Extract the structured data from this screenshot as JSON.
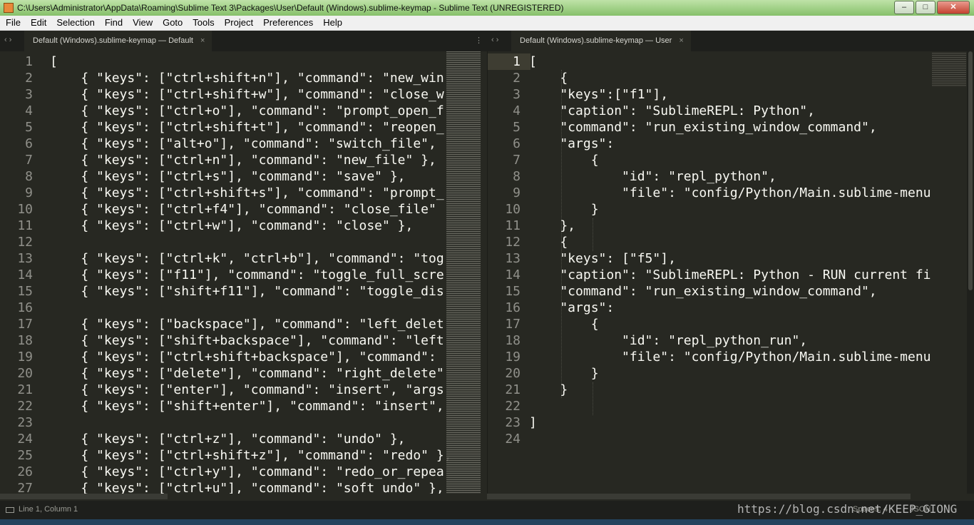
{
  "window": {
    "title": "C:\\Users\\Administrator\\AppData\\Roaming\\Sublime Text 3\\Packages\\User\\Default (Windows).sublime-keymap - Sublime Text (UNREGISTERED)",
    "minimize": "–",
    "maximize": "□",
    "close": "✕"
  },
  "menu": [
    "File",
    "Edit",
    "Selection",
    "Find",
    "View",
    "Goto",
    "Tools",
    "Project",
    "Preferences",
    "Help"
  ],
  "left_pane": {
    "tab_label": "Default (Windows).sublime-keymap — Default",
    "tab_close": "×",
    "nav": "‹ ›",
    "menu_dots": "⋮",
    "line_numbers": [
      "1",
      "2",
      "3",
      "4",
      "5",
      "6",
      "7",
      "8",
      "9",
      "10",
      "11",
      "12",
      "13",
      "14",
      "15",
      "16",
      "17",
      "18",
      "19",
      "20",
      "21",
      "22",
      "23",
      "24",
      "25",
      "26",
      "27"
    ],
    "lines": [
      "[",
      "    { \"keys\": [\"ctrl+shift+n\"], \"command\": \"new_win",
      "    { \"keys\": [\"ctrl+shift+w\"], \"command\": \"close_w",
      "    { \"keys\": [\"ctrl+o\"], \"command\": \"prompt_open_f",
      "    { \"keys\": [\"ctrl+shift+t\"], \"command\": \"reopen_",
      "    { \"keys\": [\"alt+o\"], \"command\": \"switch_file\",",
      "    { \"keys\": [\"ctrl+n\"], \"command\": \"new_file\" },",
      "    { \"keys\": [\"ctrl+s\"], \"command\": \"save\" },",
      "    { \"keys\": [\"ctrl+shift+s\"], \"command\": \"prompt_",
      "    { \"keys\": [\"ctrl+f4\"], \"command\": \"close_file\"",
      "    { \"keys\": [\"ctrl+w\"], \"command\": \"close\" },",
      "",
      "    { \"keys\": [\"ctrl+k\", \"ctrl+b\"], \"command\": \"tog",
      "    { \"keys\": [\"f11\"], \"command\": \"toggle_full_scre",
      "    { \"keys\": [\"shift+f11\"], \"command\": \"toggle_dis",
      "",
      "    { \"keys\": [\"backspace\"], \"command\": \"left_delet",
      "    { \"keys\": [\"shift+backspace\"], \"command\": \"left",
      "    { \"keys\": [\"ctrl+shift+backspace\"], \"command\":",
      "    { \"keys\": [\"delete\"], \"command\": \"right_delete\"",
      "    { \"keys\": [\"enter\"], \"command\": \"insert\", \"args",
      "    { \"keys\": [\"shift+enter\"], \"command\": \"insert\",",
      "",
      "    { \"keys\": [\"ctrl+z\"], \"command\": \"undo\" },",
      "    { \"keys\": [\"ctrl+shift+z\"], \"command\": \"redo\" },",
      "    { \"keys\": [\"ctrl+y\"], \"command\": \"redo_or_repea",
      "    { \"keys\": [\"ctrl+u\"], \"command\": \"soft_undo\" },"
    ]
  },
  "right_pane": {
    "tab_label": "Default (Windows).sublime-keymap — User",
    "tab_close": "×",
    "nav": "‹ ›",
    "line_numbers": [
      "1",
      "2",
      "3",
      "4",
      "5",
      "6",
      "7",
      "8",
      "9",
      "10",
      "11",
      "12",
      "13",
      "14",
      "15",
      "16",
      "17",
      "18",
      "19",
      "20",
      "21",
      "22",
      "23",
      "24"
    ],
    "lines": [
      "[",
      "    {",
      "    \"keys\":[\"f1\"],",
      "    \"caption\": \"SublimeREPL: Python\",",
      "    \"command\": \"run_existing_window_command\",",
      "    \"args\":",
      "        {",
      "            \"id\": \"repl_python\",",
      "            \"file\": \"config/Python/Main.sublime-menu",
      "        }",
      "    },",
      "    {",
      "    \"keys\": [\"f5\"],",
      "    \"caption\": \"SublimeREPL: Python - RUN current fi",
      "    \"command\": \"run_existing_window_command\",",
      "    \"args\":",
      "        {",
      "            \"id\": \"repl_python_run\",",
      "            \"file\": \"config/Python/Main.sublime-menu",
      "        }",
      "    }",
      "",
      "]",
      ""
    ]
  },
  "status": {
    "position": "Line 1, Column 1",
    "spaces": "Spaces: 4",
    "syntax": "JSON"
  },
  "watermark": "https://blog.csdn.net/KEEP_GIONG",
  "colors": {
    "editor_bg": "#272822",
    "foreground": "#f8f8f2",
    "gutter_fg": "#90908a",
    "title_bar": "#9fd18a"
  }
}
